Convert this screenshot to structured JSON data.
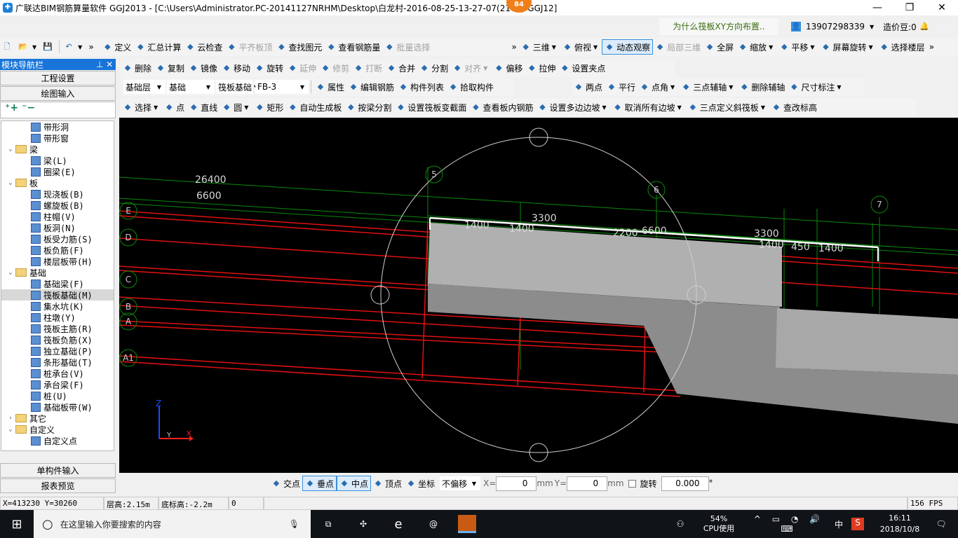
{
  "title": "广联达BIM钢筋算量软件 GGJ2013 - [C:\\Users\\Administrator.PC-20141127NRHM\\Desktop\\白龙村-2016-08-25-13-27-07(2161)-GGJ12]",
  "badge": "84",
  "help_link": "为什么筏板XY方向布置..",
  "user": "13907298339",
  "beans": "造价豆:0",
  "toolbar1": [
    "定义",
    "汇总计算",
    "云检查",
    "平齐板顶",
    "查找图元",
    "查看钢筋量",
    "批量选择"
  ],
  "toolbar1_disabled": [
    false,
    false,
    false,
    true,
    false,
    false,
    true
  ],
  "view_toolbar": [
    "三维",
    "俯视",
    "动态观察",
    "局部三维",
    "全屏",
    "缩放",
    "平移",
    "屏幕旋转",
    "选择楼层"
  ],
  "edit_toolbar": [
    "删除",
    "复制",
    "镜像",
    "移动",
    "旋转",
    "延伸",
    "修剪",
    "打断",
    "合并",
    "分割",
    "对齐",
    "偏移",
    "拉伸",
    "设置夹点"
  ],
  "edit_disabled": [
    false,
    false,
    false,
    false,
    false,
    true,
    true,
    true,
    false,
    false,
    true,
    false,
    false,
    false
  ],
  "selectors": {
    "floor": "基础层",
    "category": "基础",
    "type": "筏板基础",
    "element": "FB-3"
  },
  "prop_toolbar": [
    "属性",
    "编辑钢筋",
    "构件列表",
    "拾取构件"
  ],
  "axis_toolbar": [
    "两点",
    "平行",
    "点角",
    "三点辅轴",
    "删除辅轴",
    "尺寸标注"
  ],
  "draw_toolbar": [
    "选择",
    "点",
    "直线",
    "圆",
    "矩形",
    "自动生成板",
    "按梁分割",
    "设置筏板变截面",
    "查看板内钢筋",
    "设置多边边坡",
    "取消所有边坡",
    "三点定义斜筏板",
    "查改标高"
  ],
  "nav": {
    "title": "模块导航栏",
    "buttons": [
      "工程设置",
      "绘图输入"
    ],
    "bottom_buttons": [
      "单构件输入",
      "报表预览"
    ],
    "tree": [
      {
        "label": "带形洞",
        "level": 2
      },
      {
        "label": "带形窗",
        "level": 2
      },
      {
        "label": "梁",
        "level": 1
      },
      {
        "label": "梁(L)",
        "level": 2
      },
      {
        "label": "圈梁(E)",
        "level": 2
      },
      {
        "label": "板",
        "level": 1
      },
      {
        "label": "现浇板(B)",
        "level": 2
      },
      {
        "label": "螺旋板(B)",
        "level": 2
      },
      {
        "label": "柱帽(V)",
        "level": 2
      },
      {
        "label": "板洞(N)",
        "level": 2
      },
      {
        "label": "板受力筋(S)",
        "level": 2
      },
      {
        "label": "板负筋(F)",
        "level": 2
      },
      {
        "label": "楼层板带(H)",
        "level": 2
      },
      {
        "label": "基础",
        "level": 1
      },
      {
        "label": "基础梁(F)",
        "level": 2
      },
      {
        "label": "筏板基础(M)",
        "level": 2,
        "selected": true
      },
      {
        "label": "集水坑(K)",
        "level": 2
      },
      {
        "label": "柱墩(Y)",
        "level": 2
      },
      {
        "label": "筏板主筋(R)",
        "level": 2
      },
      {
        "label": "筏板负筋(X)",
        "level": 2
      },
      {
        "label": "独立基础(P)",
        "level": 2
      },
      {
        "label": "条形基础(T)",
        "level": 2
      },
      {
        "label": "桩承台(V)",
        "level": 2
      },
      {
        "label": "承台梁(F)",
        "level": 2
      },
      {
        "label": "桩(U)",
        "level": 2
      },
      {
        "label": "基础板带(W)",
        "level": 2
      },
      {
        "label": "其它",
        "level": 1,
        "collapsed": true
      },
      {
        "label": "自定义",
        "level": 1
      },
      {
        "label": "自定义点",
        "level": 2
      }
    ]
  },
  "canvas": {
    "dims": [
      "26400",
      "6600",
      "3300",
      "1400",
      "1400",
      "2200",
      "6600",
      "3300",
      "1400",
      "450",
      "1400"
    ],
    "axes_rows": [
      "E",
      "D",
      "C",
      "B",
      "A",
      "A1"
    ],
    "axes_cols": [
      "5",
      "6",
      "7"
    ],
    "axis_z": "Z",
    "axis_x": "X",
    "axis_y": "Y"
  },
  "snap": {
    "items": [
      "交点",
      "垂点",
      "中点",
      "顶点",
      "坐标"
    ],
    "offset": "不偏移",
    "x_label": "X=",
    "x": "0",
    "y_label": "Y=",
    "y": "0",
    "unit": "mm",
    "rotate_label": "旋转",
    "rotate": "0.000",
    "deg": "°"
  },
  "status": {
    "coords": "X=413230 Y=30260",
    "floor_height": "层高:2.15m",
    "bottom_elev": "底标高:-2.2m",
    "value": "0",
    "fps": "156 FPS"
  },
  "taskbar": {
    "search": "在这里输入你要搜索的内容",
    "cpu": "54%",
    "cpu_label": "CPU使用",
    "ime": "中",
    "time": "16:11",
    "date": "2018/10/8"
  }
}
